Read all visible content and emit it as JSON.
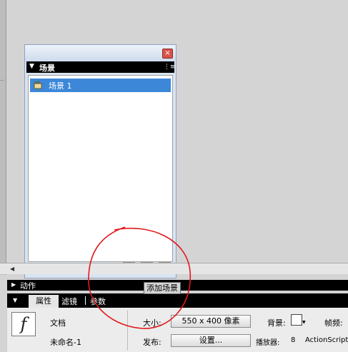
{
  "scene_panel": {
    "close_glyph": "×",
    "header_arrow": "▼",
    "title": "场景",
    "menu_glyph": "⋮≡",
    "scenes": [
      {
        "label": "场景 1"
      }
    ],
    "add_glyph": "+"
  },
  "tooltip": "添加场景",
  "actions_panel": {
    "arrow": "▶",
    "label": "动作"
  },
  "tabs": {
    "arrow": "▼",
    "properties": "属性",
    "filters": "滤镜",
    "parameters": "参数"
  },
  "document": {
    "logo_glyph": "f",
    "type_label": "文档",
    "name": "未命名-1",
    "size_label": "大小:",
    "size_value": "550 x 400 像素",
    "background_label": "背景:",
    "background_color": "#ffffff",
    "fps_label": "帧频:",
    "publish_label": "发布:",
    "settings_button": "设置...",
    "player_label": "播放器:",
    "player_value": "8",
    "actionscript_label": "ActionScript"
  },
  "colors": {
    "highlight": "#3c87d8",
    "annotation": "#e0191b"
  }
}
